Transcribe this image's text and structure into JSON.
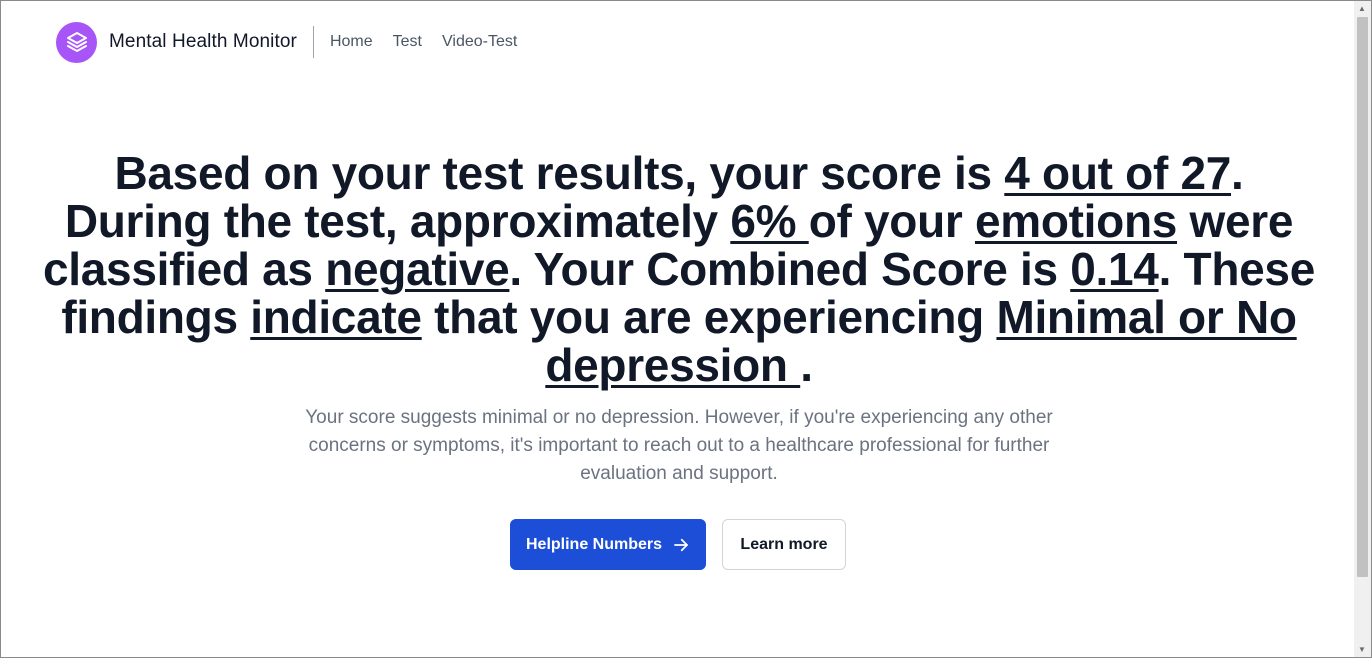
{
  "nav": {
    "brand": "Mental Health Monitor",
    "links": [
      "Home",
      "Test",
      "Video-Test"
    ]
  },
  "result": {
    "p1": "Based on your test results, your score is ",
    "score": "4 out of 27",
    "p2": ". During the test, approximately ",
    "negative_percent": "6% ",
    "p3": "of your ",
    "emotions_word": "emotions",
    "p4": " were classified as ",
    "negative_word": "negative",
    "p5": ". Your Combined Score is ",
    "combined_score": "0.14",
    "p6": ". These findings ",
    "indicate_word": "indicate",
    "p7": " that you are experiencing ",
    "level": "Minimal or No depression ",
    "p8": "."
  },
  "description": "Your score suggests minimal or no depression. However, if you're experiencing any other concerns or symptoms, it's important to reach out to a healthcare professional for further evaluation and support.",
  "buttons": {
    "helpline": "Helpline Numbers",
    "learn_more": "Learn more"
  },
  "colors": {
    "logo_bg": "#a855f7",
    "primary_button": "#1d4ed8",
    "heading": "#111827"
  },
  "icons": {
    "logo": "layers-icon",
    "helpline_arrow": "arrow-right-icon"
  }
}
